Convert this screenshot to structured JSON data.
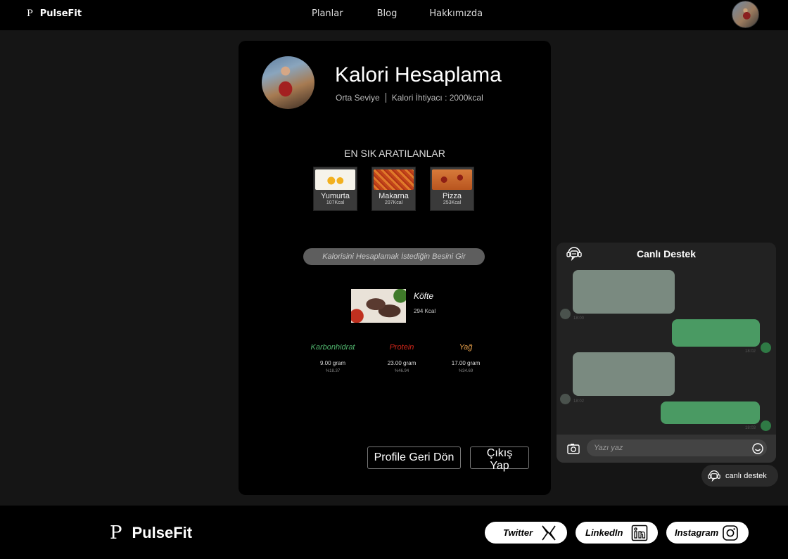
{
  "header": {
    "brand_logo": "P",
    "brand_name": "PulseFit",
    "nav": [
      "Planlar",
      "Blog",
      "Hakkımızda"
    ]
  },
  "card": {
    "title": "Kalori Hesaplama",
    "level": "Orta Seviye",
    "calorie_need": "Kalori İhtiyacı : 2000kcal",
    "popular_heading": "EN SIK ARATILANLAR",
    "popular": [
      {
        "name": "Yumurta",
        "kcal": "107Kcal"
      },
      {
        "name": "Makarna",
        "kcal": "207Kcal"
      },
      {
        "name": "Pizza",
        "kcal": "253Kcal"
      }
    ],
    "search_placeholder": "Kalorisini Hesaplamak İstediğin Besini Gir",
    "result": {
      "name": "Köfte",
      "kcal": "294 Kcal"
    },
    "macros": [
      {
        "name": "Karbonhidrat",
        "value": "9.00 gram",
        "percent": "%18.37"
      },
      {
        "name": "Protein",
        "value": "23.00 gram",
        "percent": "%46.94"
      },
      {
        "name": "Yağ",
        "value": "17.00 gram",
        "percent": "%34.69"
      }
    ],
    "buttons": {
      "profile": "Profile Geri Dön",
      "exit": "Çıkış Yap"
    }
  },
  "chat": {
    "title": "Canlı Destek",
    "messages": [
      {
        "side": "in",
        "time": "18:00"
      },
      {
        "side": "out",
        "time": "18:02"
      },
      {
        "side": "in",
        "time": "18:02"
      },
      {
        "side": "out",
        "time": "18:03"
      }
    ],
    "input_placeholder": "Yazı yaz",
    "toggle_label": "canlı destek"
  },
  "footer": {
    "brand_logo": "P",
    "brand_name": "PulseFit",
    "social": [
      "Twitter",
      "LinkedIn",
      "Instagram"
    ]
  },
  "colors": {
    "carb": "#4fb36c",
    "protein": "#d2261a",
    "fat": "#e9a14a",
    "chat_out": "#4a9a63",
    "chat_in": "#7a8a80"
  }
}
